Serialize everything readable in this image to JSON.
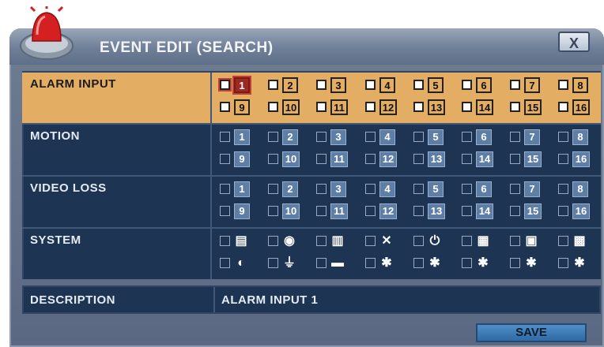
{
  "dialog": {
    "title": "EVENT EDIT (SEARCH)",
    "close_label": "X",
    "save_label": "SAVE"
  },
  "sections": [
    {
      "label": "ALARM INPUT",
      "selected": true,
      "active_channel": 1,
      "channels": [
        "1",
        "2",
        "3",
        "4",
        "5",
        "6",
        "7",
        "8",
        "9",
        "10",
        "11",
        "12",
        "13",
        "14",
        "15",
        "16"
      ]
    },
    {
      "label": "MOTION",
      "selected": false,
      "channels": [
        "1",
        "2",
        "3",
        "4",
        "5",
        "6",
        "7",
        "8",
        "9",
        "10",
        "11",
        "12",
        "13",
        "14",
        "15",
        "16"
      ]
    },
    {
      "label": "VIDEO LOSS",
      "selected": false,
      "channels": [
        "1",
        "2",
        "3",
        "4",
        "5",
        "6",
        "7",
        "8",
        "9",
        "10",
        "11",
        "12",
        "13",
        "14",
        "15",
        "16"
      ]
    },
    {
      "label": "SYSTEM",
      "selected": false,
      "icons": [
        "disk-full-icon",
        "disk-bad-icon",
        "disk-error-icon",
        "fan-fail-icon",
        "power-fail-icon",
        "network-fail-icon",
        "disk-removed-icon",
        "video-fail-icon",
        "login-fail-icon",
        "power-restore-icon",
        "disk-config-icon",
        "temp-icon-1",
        "temp-icon-2",
        "temp-icon-3",
        "temp-icon-4",
        "temp-icon-5"
      ]
    }
  ],
  "description": {
    "label": "DESCRIPTION",
    "value": "ALARM INPUT 1"
  },
  "colors": {
    "selected_row": "#e3ad63",
    "panel": "#1d3452",
    "active_channel": "#9b2a22"
  }
}
